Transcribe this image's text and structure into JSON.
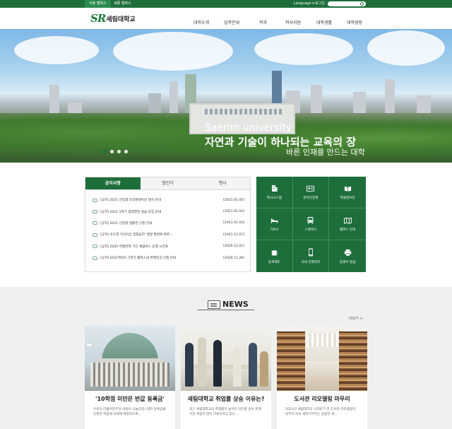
{
  "topbar": {
    "campus_seoul": "서울 캠퍼스",
    "campus_sejong": "세종 캠퍼스",
    "language": "Language ▾",
    "login": "로그인"
  },
  "header": {
    "logo_mark": "SR",
    "logo_name": "세림대학교",
    "nav": [
      "대학소개",
      "입학안내",
      "학과",
      "학사지원",
      "대학생활",
      "대학광장"
    ]
  },
  "hero": {
    "subtitle": "Saerim university",
    "title": "자연과 기술이 하나되는 교육의 장",
    "tagline": "바른 인재를 만드는 대학"
  },
  "notice": {
    "tabs": [
      "공지사항",
      "캘린더",
      "행사"
    ],
    "active_tab": 0,
    "items": [
      {
        "title": "[공지] 2021 신입생 오리엔테이션 행사 안내",
        "date": "[2021.01.05]"
      },
      {
        "title": "[공지] 2021 1학기 휴업현장 실습 모집 안내",
        "date": "[2021.01.04]"
      },
      {
        "title": "[공지] 2021 신입생 생활관 신청 안내",
        "date": "[2021.01.03]"
      },
      {
        "title": "[공지] 수도권 '5인이상 집합금지' 행정 명령에 따른...",
        "date": "[2021.12.07]"
      },
      {
        "title": "[공지] 2020 저열번역 기간 세림버스 운행 시간표",
        "date": "[2020.12.01]"
      },
      {
        "title": "[공지] 2021학년도 1학기 캠퍼스내 면제전공 신청 안내",
        "date": "[2020.11.26]"
      }
    ]
  },
  "quick_menu": [
    {
      "label": "학사시스템",
      "icon": "building-icon"
    },
    {
      "label": "온라인증명",
      "icon": "id-card-icon"
    },
    {
      "label": "학술정보관",
      "icon": "book-icon"
    },
    {
      "label": "기숙사",
      "icon": "bed-icon"
    },
    {
      "label": "스쿨버스",
      "icon": "bus-icon"
    },
    {
      "label": "캠퍼스 안내",
      "icon": "map-icon"
    },
    {
      "label": "등록제도",
      "icon": "coins-icon"
    },
    {
      "label": "교내 전화번호",
      "icon": "phone-icon"
    },
    {
      "label": "증명서 발급",
      "icon": "printer-icon"
    }
  ],
  "news": {
    "heading": "NEWS",
    "more": "더보기 +",
    "cards": [
      {
        "title": "'10학점 미만은 반값 등록금'",
        "desc": "우원식 더불어민주당 의원이 오늘(5일) 대학 등록금을 신청한 학점에 비례해 책정하도록..."
      },
      {
        "title": "세림대학교 취업률 상승 이유는?",
        "desc": "최근 세림대학교의 취업률이 높아진 이유를 알아 위해 가장 취업이 많이 이루어지고 있는..."
      },
      {
        "title": "도서관 리모델링 마무리",
        "desc": "2021년 세림대학교 시작되기 전 도서관 리모델링이 마무리 되어 새학기부터는 꿈같은 새..."
      }
    ]
  },
  "colors": {
    "brand_green": "#1e6e3c",
    "quick_bg": "#1e6e3c",
    "news_bg": "#eef1ef"
  }
}
